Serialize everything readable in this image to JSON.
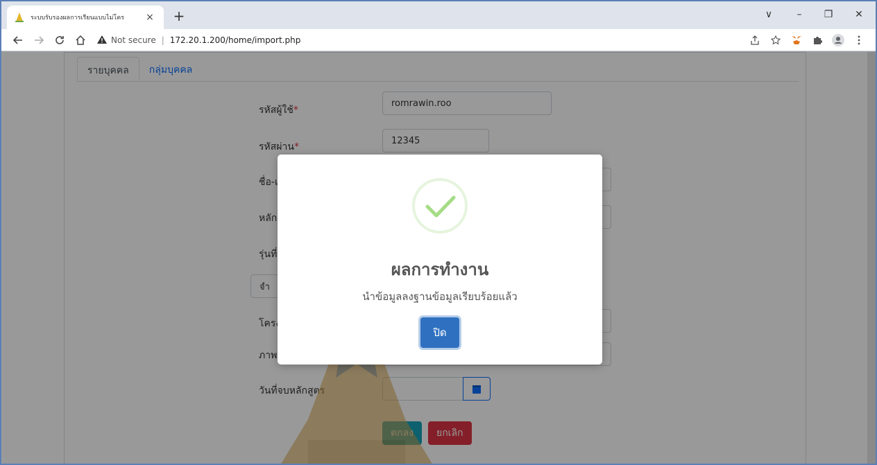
{
  "browser": {
    "tab_title": "ระบบรับรองผลการเรียนแบบไม่โคร",
    "tab_close": "×",
    "new_tab": "+",
    "not_secure": "Not secure",
    "separator": "|",
    "url": "172.20.1.200/home/import.php",
    "win_dropdown": "∨",
    "win_minimize": "–",
    "win_restore": "❐",
    "win_close": "✕"
  },
  "page": {
    "tabs": [
      {
        "label": "รายบุคคล"
      },
      {
        "label": "กลุ่มบุคคล"
      }
    ],
    "form": {
      "user_id_label": "รหัสผู้ใช้",
      "user_id_value": "romrawin.roo",
      "password_label": "รหัสผ่าน",
      "password_value": "12345",
      "required_mark": "*",
      "name_label_partial": "ชื่อ-เ",
      "course_label_partial": "หลัก",
      "batch_label_partial": "รุ่นที่",
      "select_partial": "จำ",
      "project_label_partial": "โครง",
      "image_label_partial": "ภาพ",
      "graduation_date_label": "วันที่จบหลักสูตร",
      "ok_button": "ตกลง",
      "cancel_button": "ยกเลิก"
    }
  },
  "modal": {
    "title": "ผลการทำงาน",
    "message": "นำข้อมูลลงฐานข้อมูลเรียบร้อยแล้ว",
    "close_button": "ปิด",
    "success_color": "#a5dc86"
  },
  "colors": {
    "primary": "#2f71c0",
    "ok": "#17a2b8",
    "cancel": "#dc3545",
    "link": "#0d6efd"
  }
}
